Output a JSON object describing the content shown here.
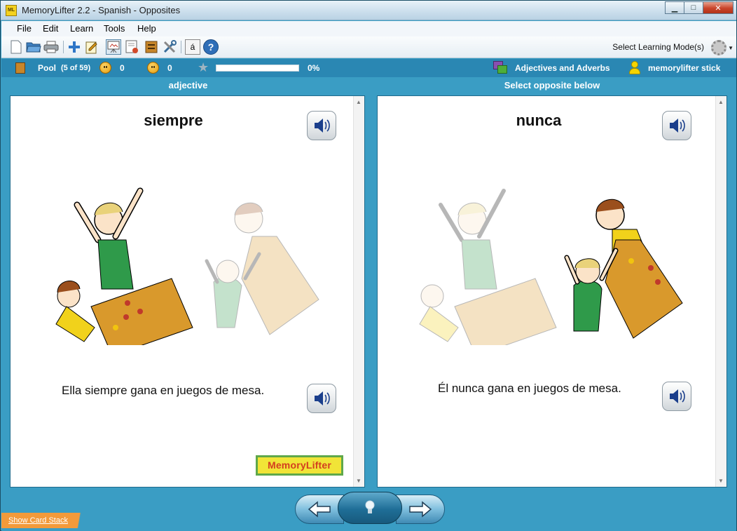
{
  "window": {
    "title": "MemoryLifter 2.2 - Spanish - Opposites",
    "app_icon_text": "ML",
    "minimize_glyph": "▁",
    "maximize_glyph": "□",
    "close_glyph": "✕"
  },
  "menu": {
    "items": [
      "File",
      "Edit",
      "Learn",
      "Tools",
      "Help"
    ]
  },
  "toolbar": {
    "buttons": [
      "new-document-icon",
      "open-folder-icon",
      "print-icon",
      "add-card-icon",
      "edit-notepad-icon",
      "slideshow-icon",
      "card-view-icon",
      "stack-icon",
      "tools-icon",
      "special-char-icon",
      "help-icon"
    ],
    "special_char_label": "á",
    "help_label": "?",
    "mode_label": "Select Learning Mode(s)"
  },
  "status": {
    "pool_label": "Pool",
    "pool_count": "(5 of 59)",
    "correct_count": "0",
    "wrong_count": "0",
    "progress_value": 0,
    "progress_text": "0%",
    "category": "Adjectives and Adverbs",
    "user": "memorylifter stick"
  },
  "columns": {
    "left_header": "adjective",
    "right_header": "Select opposite below"
  },
  "question": {
    "word": "siempre",
    "sentence": "Ella siempre gana en juegos de mesa."
  },
  "answer": {
    "word": "nunca",
    "sentence": "Él nunca gana en juegos de mesa."
  },
  "logo_text": "MemoryLifter",
  "bottom": {
    "show_card_stack": "Show Card Stack"
  },
  "colors": {
    "accent": "#2a87b3",
    "frame": "#3a9dc4",
    "progress_fill": "#5bb04a",
    "logo_bg": "#f1e437"
  }
}
